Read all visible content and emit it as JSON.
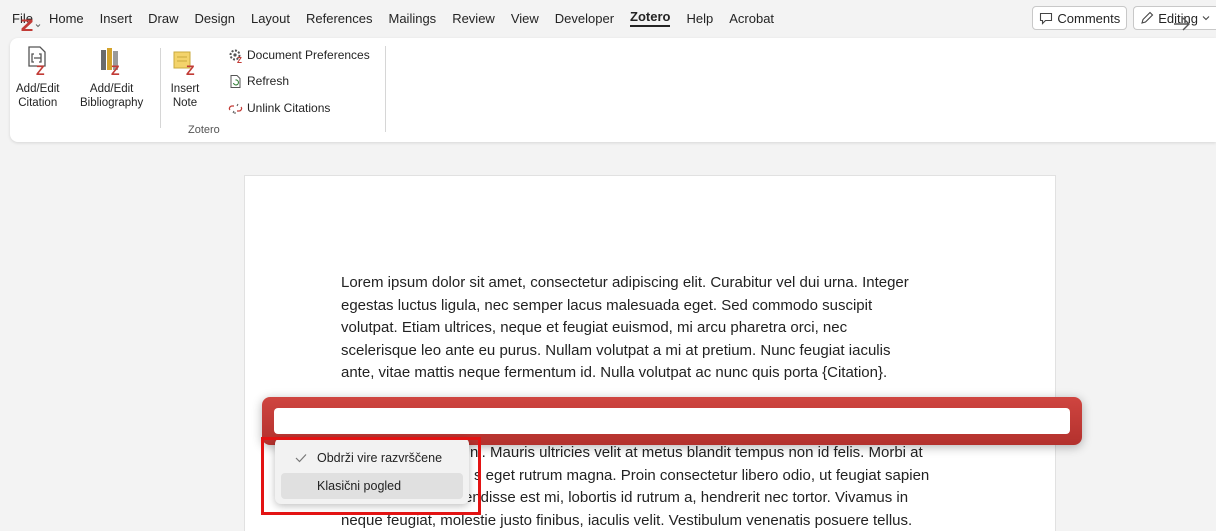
{
  "menu": {
    "items": [
      "File",
      "Home",
      "Insert",
      "Draw",
      "Design",
      "Layout",
      "References",
      "Mailings",
      "Review",
      "View",
      "Developer",
      "Zotero",
      "Help",
      "Acrobat"
    ],
    "active": "Zotero",
    "comments_label": "Comments",
    "editing_label": "Editing"
  },
  "ribbon": {
    "add_edit_citation": [
      "Add/Edit",
      "Citation"
    ],
    "add_edit_bibliography": [
      "Add/Edit",
      "Bibliography"
    ],
    "insert_note": [
      "Insert",
      "Note"
    ],
    "document_preferences": "Document Preferences",
    "refresh": "Refresh",
    "unlink_citations": "Unlink Citations",
    "group_label": "Zotero"
  },
  "document": {
    "paragraph1": [
      "Lorem ipsum dolor sit amet, consectetur adipiscing elit. Curabitur vel dui urna. Integer",
      "egestas luctus ligula, nec semper lacus malesuada eget. Sed commodo suscipit",
      "volutpat. Etiam ultrices, neque et feugiat euismod, mi arcu pharetra orci, nec",
      "scelerisque leo ante eu purus. Nullam volutpat a mi at pretium. Nunc feugiat iaculis",
      "ante, vitae mattis neque fermentum id. Nulla volutpat ac nunc quis porta {Citation}."
    ],
    "paragraph2": [
      "ni. Mauris ultricies velit at metus blandit tempus non id felis. Morbi at",
      "s eget rutrum magna. Proin consectetur libero odio, ut feugiat sapien",
      "endisse est mi, lobortis id rutrum a, hendrerit nec tortor. Vivamus in",
      "neque feugiat, molestie justo finibus, iaculis velit. Vestibulum venenatis posuere tellus."
    ]
  },
  "zotero_bar": {
    "input_value": "",
    "accent": "#c23b36"
  },
  "dropdown": {
    "items": [
      {
        "label": "Obdrži vire razvrščene",
        "checked": true
      },
      {
        "label": "Klasični pogled",
        "checked": false
      }
    ]
  },
  "colors": {
    "highlight_box": "#e31313",
    "zotero_red": "#c23b36"
  }
}
